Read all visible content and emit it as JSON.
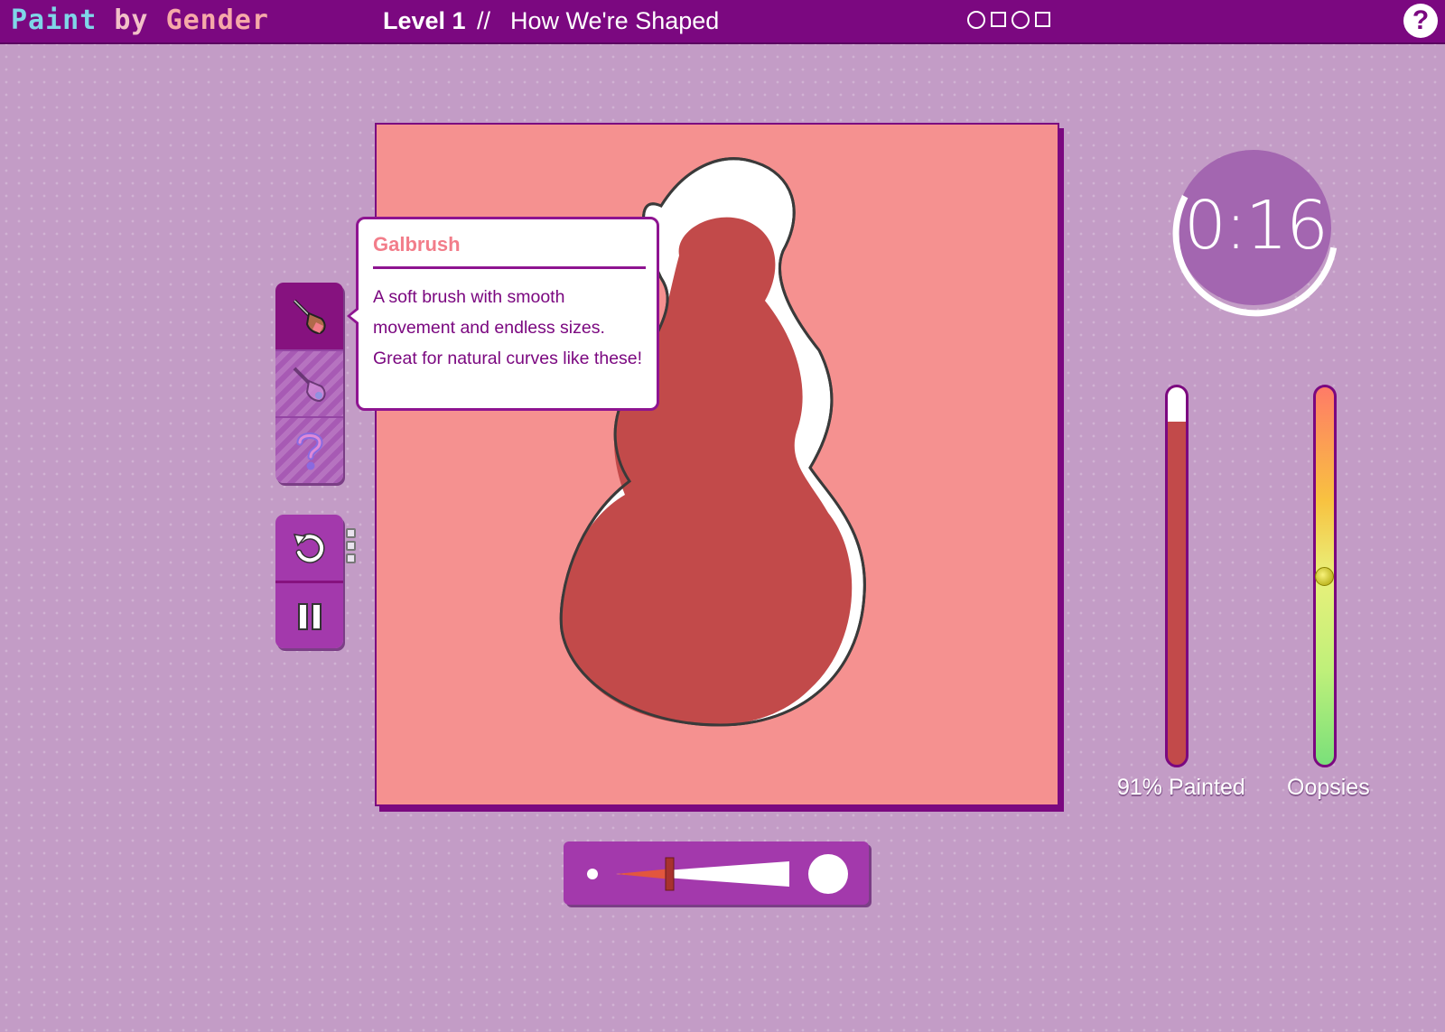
{
  "header": {
    "logo": {
      "word1": "Paint",
      "word2": "by",
      "word3": "Gender"
    },
    "level_label": "Level 1",
    "separator": "//",
    "level_name": "How We're Shaped",
    "progress_shapes": [
      "circle",
      "square",
      "circle",
      "square"
    ],
    "help_label": "?"
  },
  "tooltip": {
    "title": "Galbrush",
    "body": "A soft brush with smooth movement and endless sizes. Great for natural curves like these!"
  },
  "tools": [
    {
      "name": "galbrush",
      "icon": "paintbrush-icon",
      "active": true
    },
    {
      "name": "second-brush",
      "icon": "brush-icon",
      "active": false
    },
    {
      "name": "mystery-brush",
      "icon": "question-icon",
      "active": false
    }
  ],
  "actions": [
    {
      "name": "undo",
      "icon": "undo-icon",
      "remaining": 3
    },
    {
      "name": "pause",
      "icon": "pause-icon"
    }
  ],
  "brush_size": {
    "level": 0.18
  },
  "timer": {
    "text": "0:16",
    "progress": 0.55
  },
  "meters": {
    "painted": {
      "label": "91% Painted",
      "value": 0.91
    },
    "oopsies": {
      "label": "Oopsies",
      "value": 0.5
    }
  },
  "colors": {
    "header": "#7b0880",
    "canvas": "#f59190",
    "paint": "#c24a4a",
    "accent": "#a339ac",
    "tooltip_title": "#f27d8a"
  }
}
